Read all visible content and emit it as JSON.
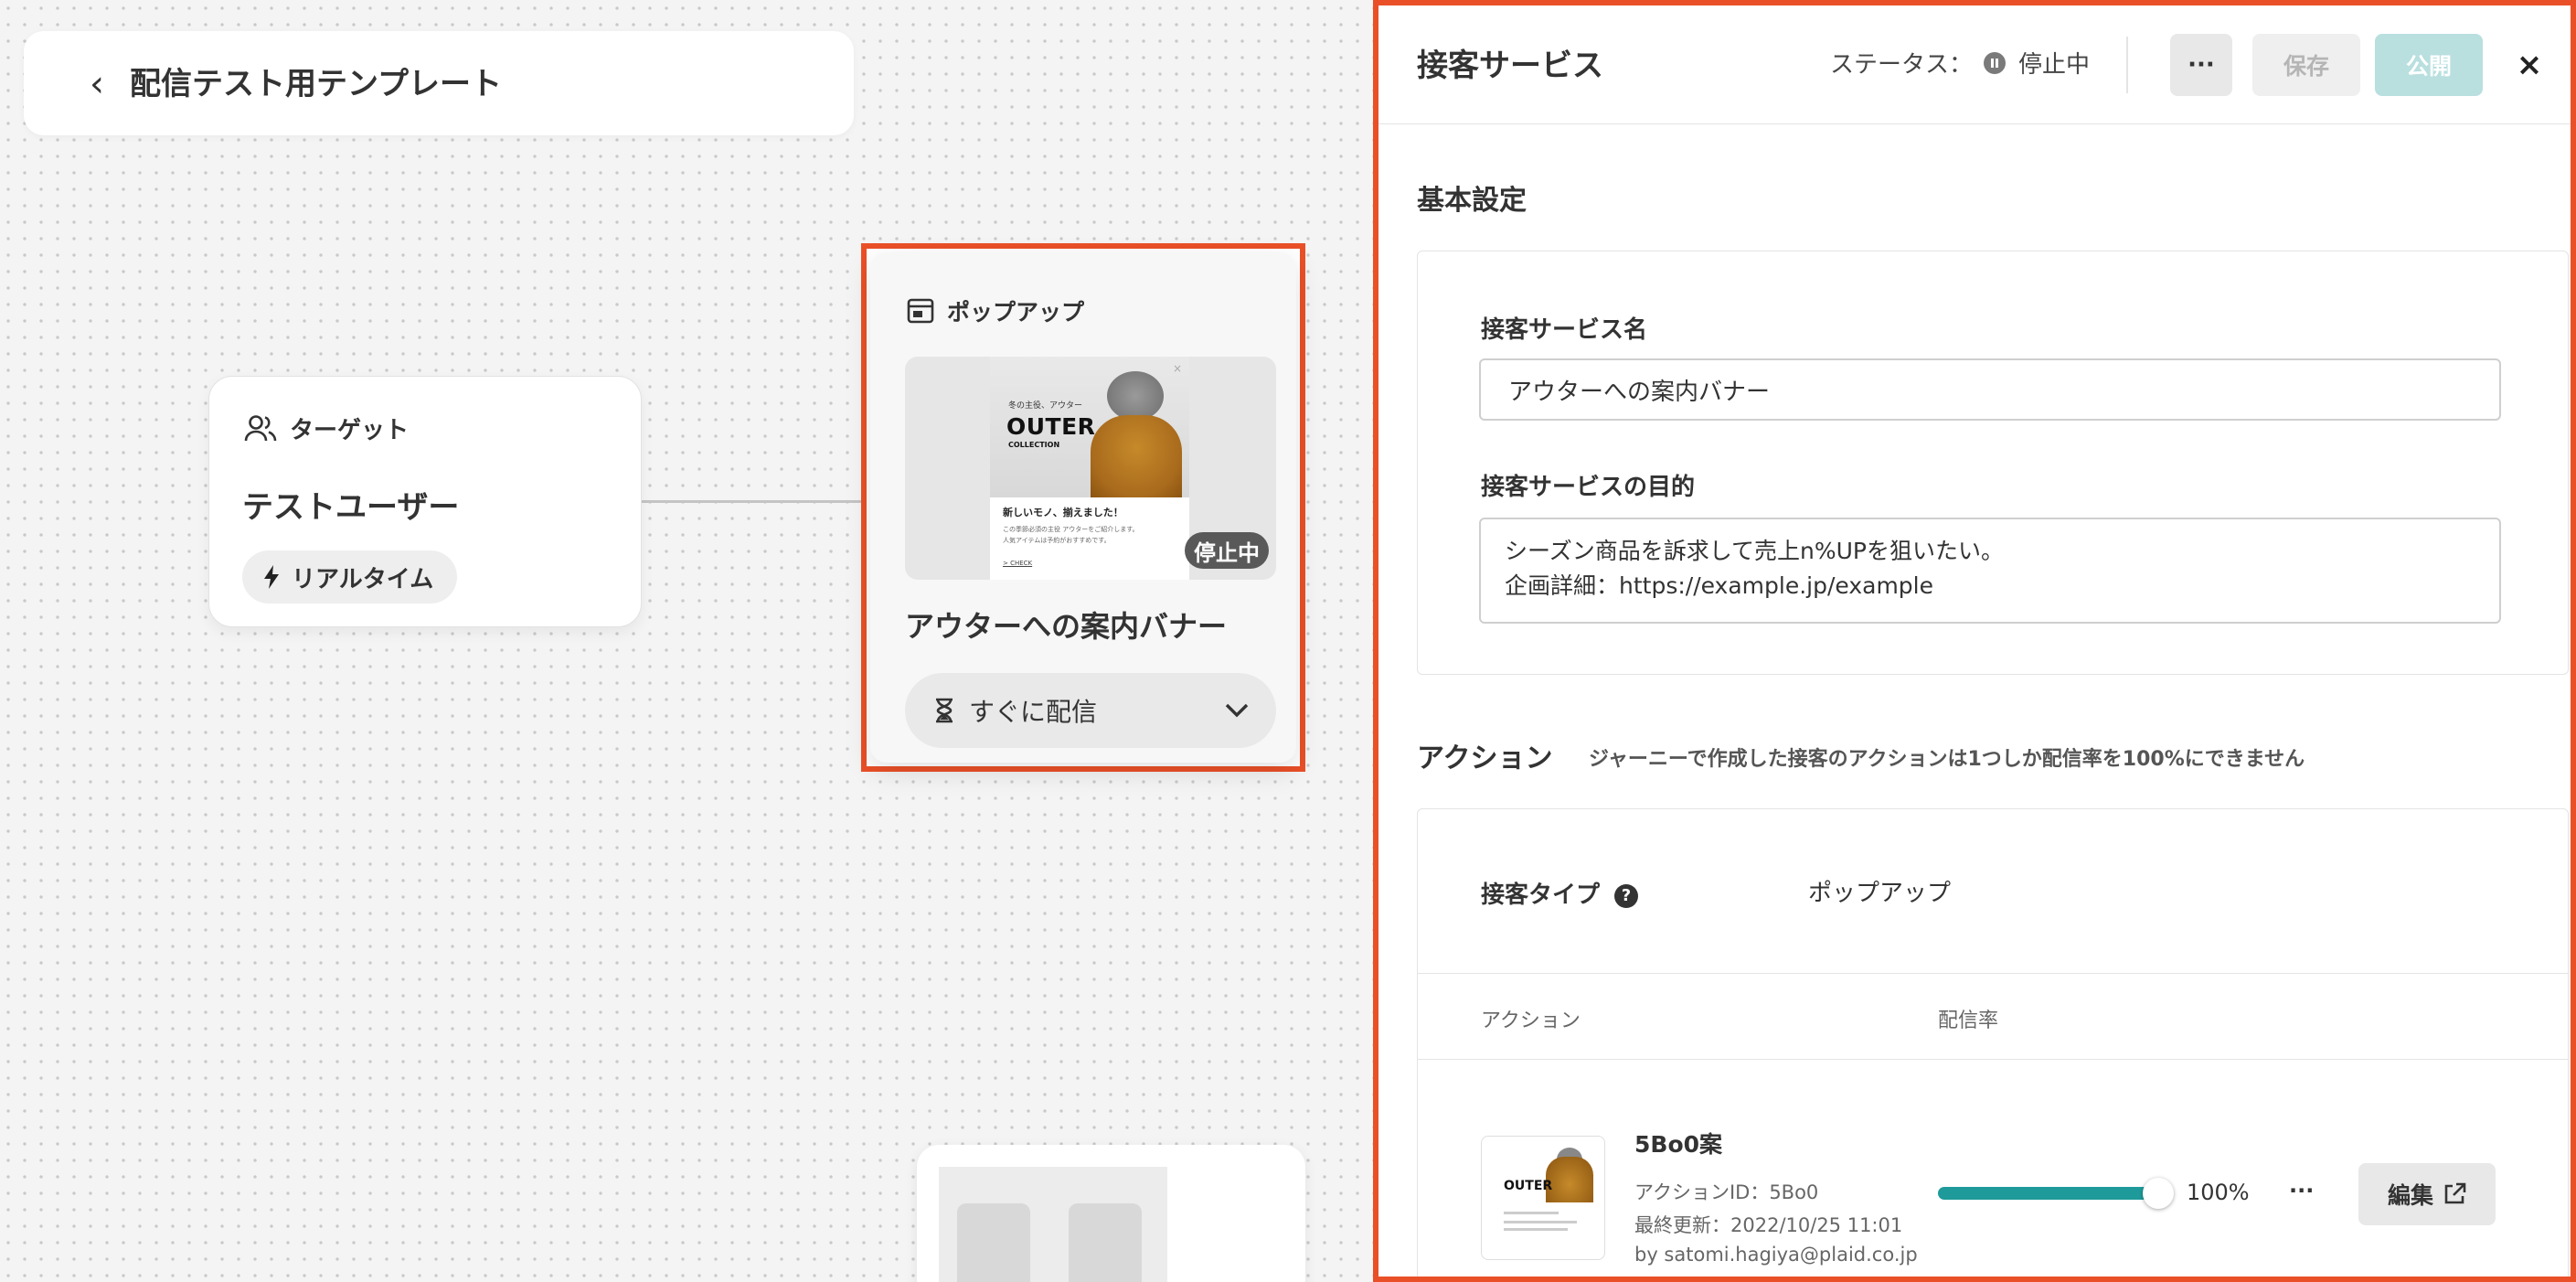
{
  "canvas": {
    "template_title": "配信テスト用テンプレート",
    "target_node": {
      "header": "ターゲット",
      "name": "テストユーザー",
      "trigger": "リアルタイム"
    },
    "popup_node": {
      "header": "ポップアップ",
      "name": "アウターへの案内バナー",
      "status_badge": "停止中",
      "delivery": "すぐに配信",
      "preview": {
        "small_text": "冬の主役、アウター",
        "headline": "OUTER",
        "subhead": "COLLECTION",
        "title": "新しいモノ、揃えました！",
        "line1": "この季節必須の主役 アウターをご紹介します。",
        "line2": "人気アイテムは予約がおすすめです。",
        "link": "> CHECK",
        "close": "×"
      }
    }
  },
  "panel": {
    "title": "接客サービス",
    "status_label": "ステータス：",
    "status_value": "停止中",
    "more_label": "···",
    "save_label": "保存",
    "publish_label": "公開",
    "close_label": "×",
    "basic_section": "基本設定",
    "name_label": "接客サービス名",
    "name_value": "アウターへの案内バナー",
    "purpose_label": "接客サービスの目的",
    "purpose_line1": "シーズン商品を訴求して売上n%UPを狙いたい。",
    "purpose_line2": "企画詳細：https://example.jp/example",
    "action_section": "アクション",
    "action_note": "ジャーニーで作成した接客のアクションは1つしか配信率を100%にできません",
    "type_label": "接客タイプ",
    "type_help": "?",
    "type_value": "ポップアップ",
    "col_action": "アクション",
    "col_rate": "配信率",
    "action": {
      "name": "5Bo0案",
      "id": "アクションID：5Bo0",
      "updated": "最終更新：2022/10/25 11:01",
      "by": "by satomi.hagiya@plaid.co.jp",
      "rate": 100,
      "rate_text": "100%",
      "more": "···",
      "edit_label": "編集",
      "thumb_text": "OUTER"
    }
  },
  "colors": {
    "accent": "#ea5028",
    "teal": "#1f9a9a",
    "publish_disabled": "#b9dfdf"
  },
  "icons": [
    "chevron-left-icon",
    "users-icon",
    "bolt-icon",
    "popup-window-icon",
    "hourglass-icon",
    "chevron-down-icon",
    "pause-icon",
    "close-icon",
    "help-icon",
    "external-link-icon"
  ]
}
